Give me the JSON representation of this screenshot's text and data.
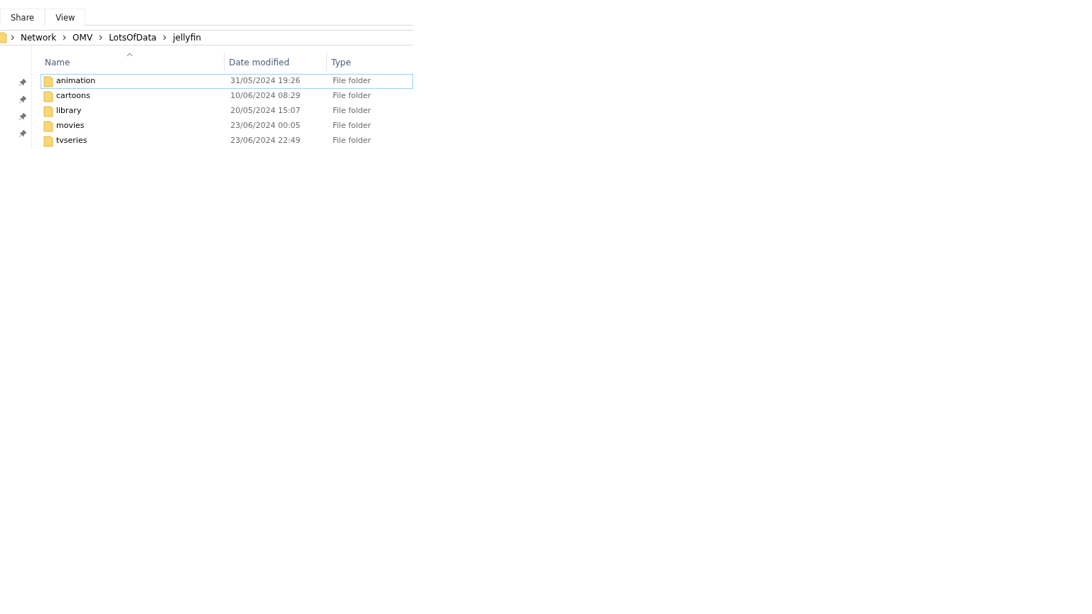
{
  "ribbon_tabs": [
    {
      "label": "Share",
      "selected": false
    },
    {
      "label": "View",
      "selected": false
    }
  ],
  "breadcrumbs": [
    "Network",
    "OMV",
    "LotsOfData",
    "jellyfin"
  ],
  "nav_pane": {
    "pinned": [
      true,
      true,
      true,
      true
    ]
  },
  "table": {
    "columns": [
      {
        "label": "Name",
        "sorted": true
      },
      {
        "label": "Date modified",
        "sorted": false
      },
      {
        "label": "Type",
        "sorted": false
      }
    ],
    "rows": [
      {
        "name": "animation",
        "date": "31/05/2024 19:26",
        "type": "File folder",
        "selected": true
      },
      {
        "name": "cartoons",
        "date": "10/06/2024 08:29",
        "type": "File folder",
        "selected": false
      },
      {
        "name": "library",
        "date": "20/05/2024 15:07",
        "type": "File folder",
        "selected": false
      },
      {
        "name": "movies",
        "date": "23/06/2024 00:05",
        "type": "File folder",
        "selected": false
      },
      {
        "name": "tvseries",
        "date": "23/06/2024 22:49",
        "type": "File folder",
        "selected": false
      }
    ]
  }
}
